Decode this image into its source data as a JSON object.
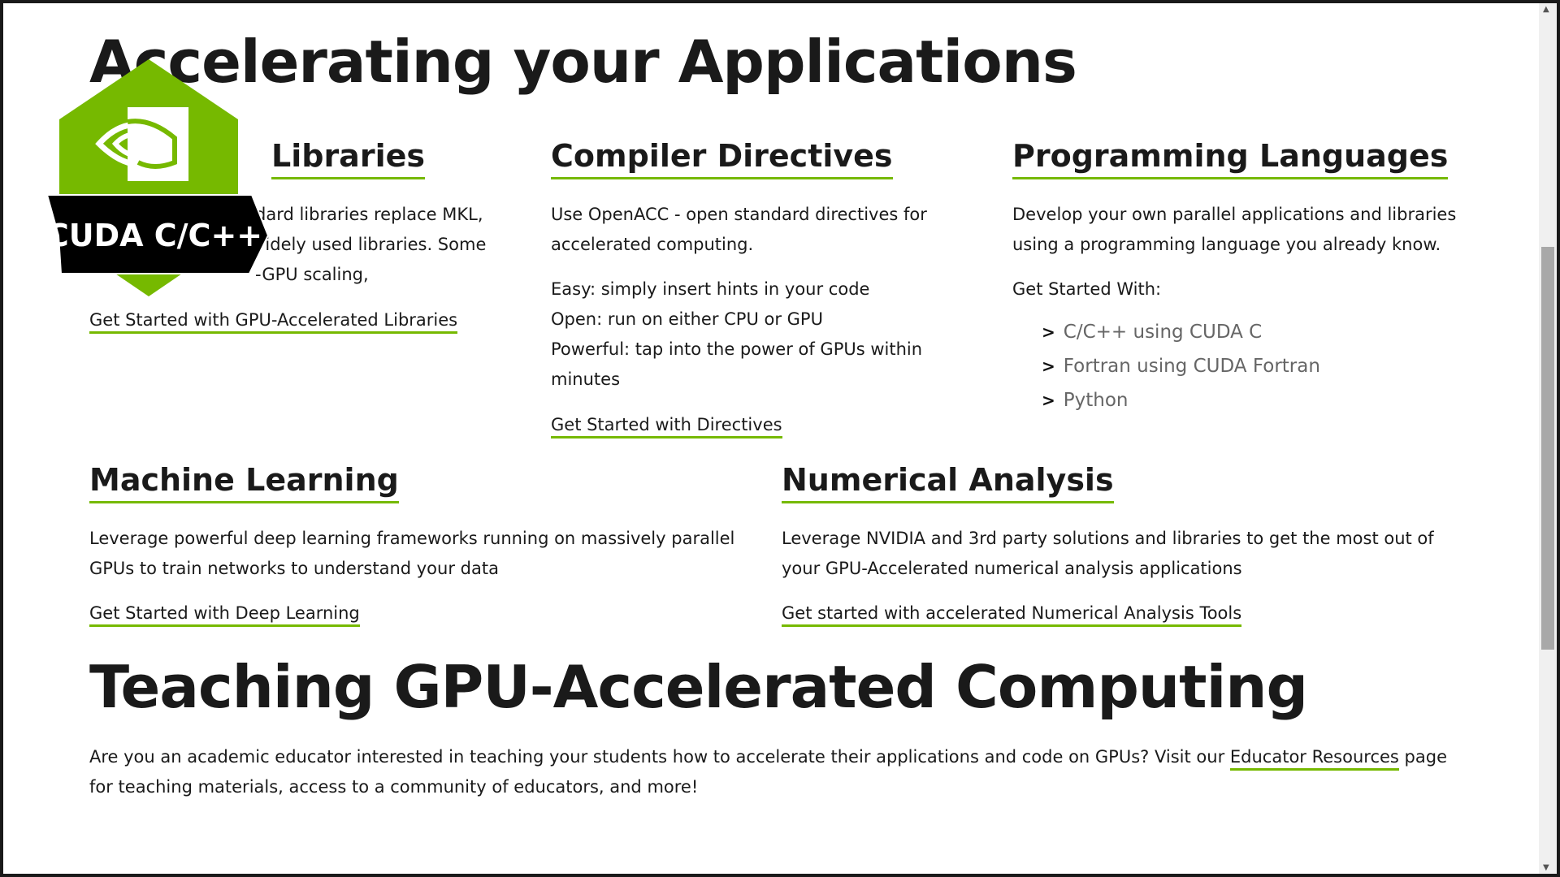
{
  "accent_color": "#76b900",
  "section1": {
    "title": "Accelerating your Applications"
  },
  "libraries": {
    "title": "Libraries",
    "lines": [
      "dard libraries replace MKL,",
      "videly used libraries. Some",
      "-GPU scaling,"
    ],
    "link": "Get Started with GPU-Accelerated Libraries"
  },
  "directives": {
    "title": "Compiler Directives",
    "desc": [
      "Use OpenACC - open standard directives for",
      "accelerated computing."
    ],
    "points": [
      "Easy: simply insert hints in your code",
      "Open: run on either CPU or GPU",
      "Powerful: tap into the power of GPUs within",
      "minutes"
    ],
    "link": "Get Started with Directives"
  },
  "languages": {
    "title": "Programming Languages",
    "desc": [
      "Develop your own parallel applications and libraries",
      "using a programming language you already know."
    ],
    "get_started": "Get Started With:",
    "bullet": ">",
    "items": [
      "C/C++ using CUDA C",
      "Fortran using CUDA Fortran",
      "Python"
    ]
  },
  "ml": {
    "title": "Machine Learning",
    "desc": [
      "Leverage powerful deep learning frameworks running on massively parallel",
      "GPUs to train networks to understand your data"
    ],
    "link": "Get Started with Deep Learning"
  },
  "numerical": {
    "title": "Numerical Analysis",
    "desc": [
      "Leverage NVIDIA and 3rd party solutions and libraries to get the most out of",
      "your GPU-Accelerated numerical analysis applications"
    ],
    "link": "Get started with accelerated Numerical Analysis Tools"
  },
  "teaching": {
    "title": "Teaching GPU-Accelerated Computing",
    "text1": "Are you an academic educator interested in teaching your students how to accelerate their applications and code on GPUs? Visit our",
    "link": "Educator Resources",
    "text2": "page",
    "line2": "for teaching materials, access to a community of educators, and more!"
  },
  "badge": {
    "label": "CUDA C/C++",
    "icon": "nvidia-eye-logo"
  }
}
